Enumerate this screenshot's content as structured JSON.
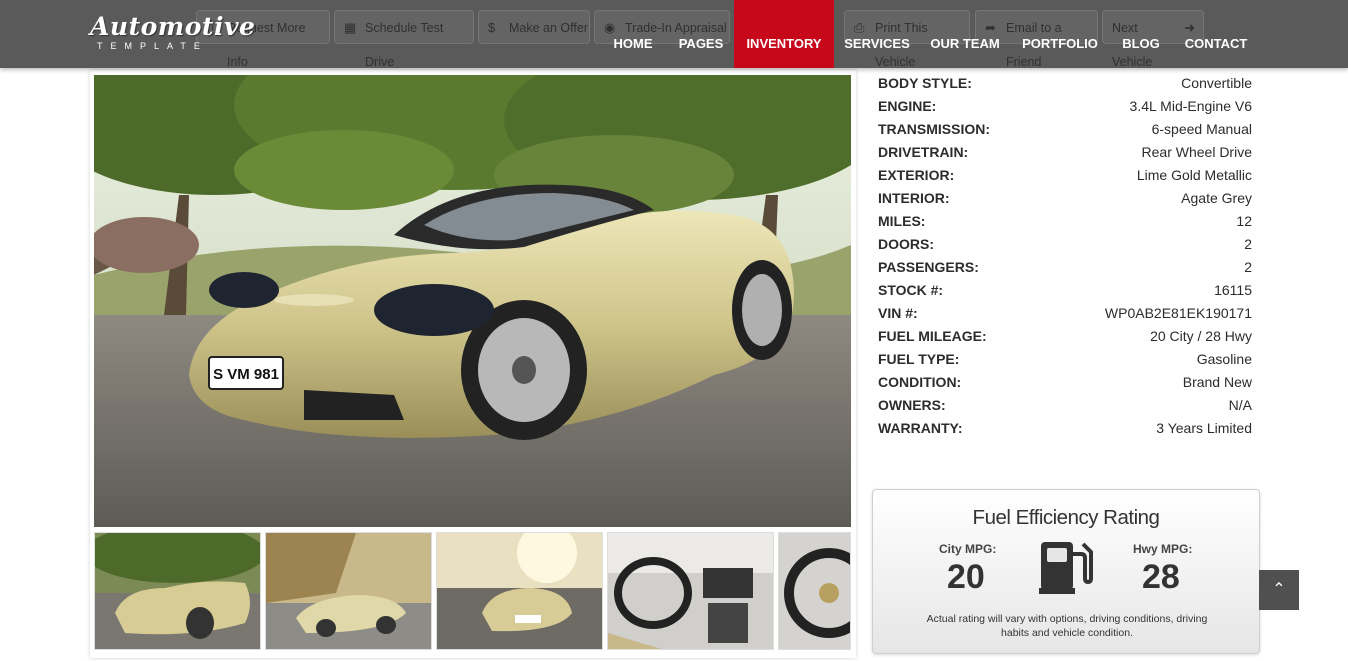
{
  "header": {
    "logo": {
      "name": "Automotive",
      "sub": "TEMPLATE"
    },
    "actions": [
      {
        "label": "Request More Info",
        "icon": "info-icon"
      },
      {
        "label": "Schedule Test Drive",
        "icon": "calendar-icon"
      },
      {
        "label": "Make an Offer",
        "icon": "dollar-icon"
      },
      {
        "label": "Trade-In Appraisal",
        "icon": "eye-icon"
      },
      {
        "label": "Print This Vehicle",
        "icon": "print-icon"
      },
      {
        "label": "Email to a Friend",
        "icon": "share-icon"
      },
      {
        "label": "Next Vehicle",
        "icon": "arrow-right-icon"
      }
    ],
    "nav": [
      {
        "label": "HOME"
      },
      {
        "label": "PAGES"
      },
      {
        "label": "INVENTORY",
        "active": true
      },
      {
        "label": "SERVICES"
      },
      {
        "label": "OUR TEAM"
      },
      {
        "label": "PORTFOLIO"
      },
      {
        "label": "BLOG"
      },
      {
        "label": "CONTACT"
      }
    ],
    "accent_color": "#c7081b"
  },
  "gallery": {
    "main_plate": "S VM 981",
    "thumbnails": [
      "thumb-front-three-quarter",
      "thumb-driving-rocks",
      "thumb-rear-road",
      "thumb-interior-dash",
      "thumb-steering-wheel"
    ]
  },
  "specs": [
    {
      "label": "BODY STYLE:",
      "value": "Convertible"
    },
    {
      "label": "ENGINE:",
      "value": "3.4L Mid-Engine V6"
    },
    {
      "label": "TRANSMISSION:",
      "value": "6-speed Manual"
    },
    {
      "label": "DRIVETRAIN:",
      "value": "Rear Wheel Drive"
    },
    {
      "label": "EXTERIOR:",
      "value": "Lime Gold Metallic"
    },
    {
      "label": "INTERIOR:",
      "value": "Agate Grey"
    },
    {
      "label": "MILES:",
      "value": "12"
    },
    {
      "label": "DOORS:",
      "value": "2"
    },
    {
      "label": "PASSENGERS:",
      "value": "2"
    },
    {
      "label": "STOCK #:",
      "value": "16115"
    },
    {
      "label": "VIN #:",
      "value": "WP0AB2E81EK190171"
    },
    {
      "label": "FUEL MILEAGE:",
      "value": "20 City / 28 Hwy"
    },
    {
      "label": "FUEL TYPE:",
      "value": "Gasoline"
    },
    {
      "label": "CONDITION:",
      "value": "Brand New"
    },
    {
      "label": "OWNERS:",
      "value": "N/A"
    },
    {
      "label": "WARRANTY:",
      "value": "3 Years Limited"
    }
  ],
  "fuel": {
    "title": "Fuel Efficiency Rating",
    "city_label": "City MPG:",
    "city_value": "20",
    "hwy_label": "Hwy MPG:",
    "hwy_value": "28",
    "note": "Actual rating will vary with options, driving conditions, driving habits and vehicle condition."
  },
  "back_to_top": {
    "icon": "chevron-up-icon"
  }
}
